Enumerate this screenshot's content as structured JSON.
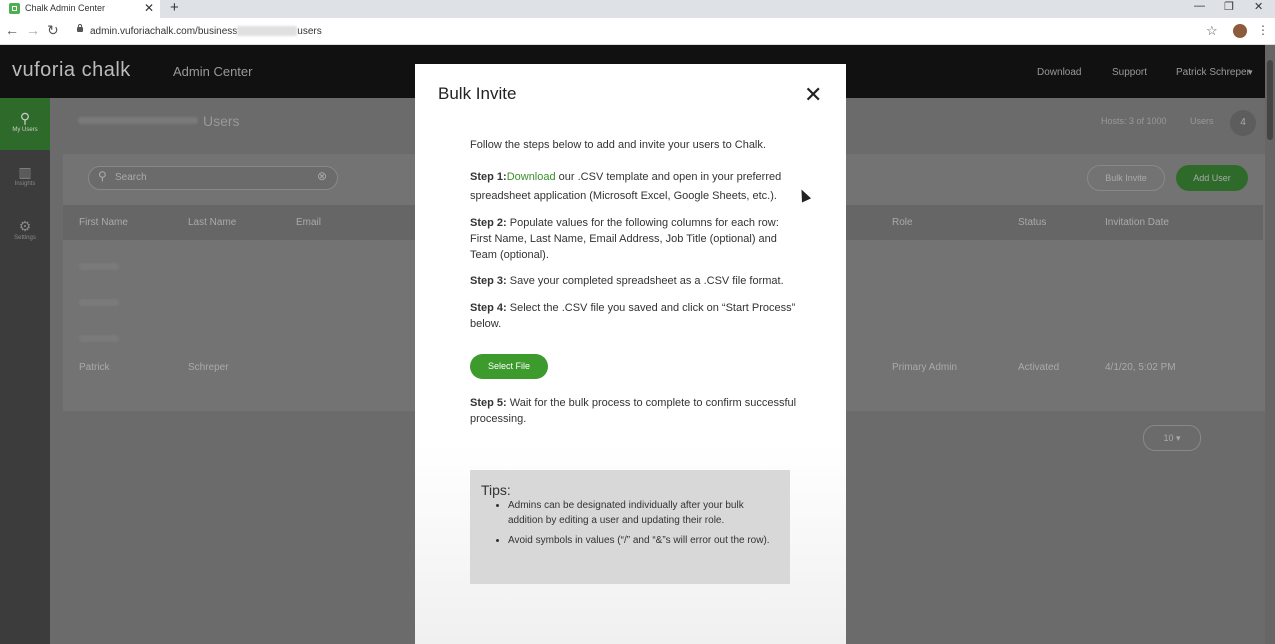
{
  "browser": {
    "tab_title": "Chalk Admin Center",
    "tab_close": "✕",
    "new_tab": "+",
    "url_prefix": "admin.vuforiachalk.com/business",
    "url_suffix": "users",
    "win_min": "—",
    "win_max": "❐",
    "win_close": "✕"
  },
  "app": {
    "logo": "vuforia chalk",
    "admin_center": "Admin Center",
    "header_links": {
      "download": "Download",
      "support": "Support",
      "user": "Patrick Schreper"
    },
    "sidebar": [
      {
        "label": "My Users",
        "icon": "user-icon"
      },
      {
        "label": "Insights",
        "icon": "chart-icon"
      },
      {
        "label": "Settings",
        "icon": "gear-icon"
      }
    ],
    "page_title": "Users",
    "hosts": "Hosts: 3 of 1000",
    "users_label": "Users",
    "users_count": "4",
    "search_placeholder": "Search",
    "bulk_invite_btn": "Bulk Invite",
    "add_user_btn": "Add User",
    "columns": [
      "First Name",
      "Last Name",
      "Email",
      "Role",
      "Status",
      "Invitation Date"
    ],
    "visible_row": {
      "first": "Patrick",
      "last": "Schreper",
      "role": "Primary Admin",
      "status": "Activated",
      "date": "4/1/20, 5:02 PM"
    },
    "page_size": "10"
  },
  "modal": {
    "title": "Bulk Invite",
    "close": "✕",
    "intro": "Follow the steps below to add and invite your users to Chalk.",
    "step1_label": "Step 1:",
    "step1_link": "Download",
    "step1_text": " our .CSV template and open in your preferred spreadsheet application (Microsoft Excel, Google Sheets, etc.).",
    "step2_label": "Step 2:",
    "step2_text": " Populate values for the following columns for each row: First Name, Last Name, Email Address, Job Title (optional) and Team (optional).",
    "step3_label": "Step 3:",
    "step3_text": " Save your completed spreadsheet as a .CSV file format.",
    "step4_label": "Step 4:",
    "step4_text": " Select the .CSV file you saved and click on “Start Process” below.",
    "select_file": "Select File",
    "step5_label": "Step 5:",
    "step5_text": " Wait for the bulk process to complete to confirm successful processing.",
    "tips_title": "Tips:",
    "tips": [
      "Admins can be designated individually after your bulk addition by editing a user and updating their role.",
      "Avoid symbols in values (“/” and “&”s will error out the row)."
    ]
  },
  "colors": {
    "accent": "#3d9b2e",
    "header": "#111111",
    "overlay": "#6b6b6b"
  }
}
